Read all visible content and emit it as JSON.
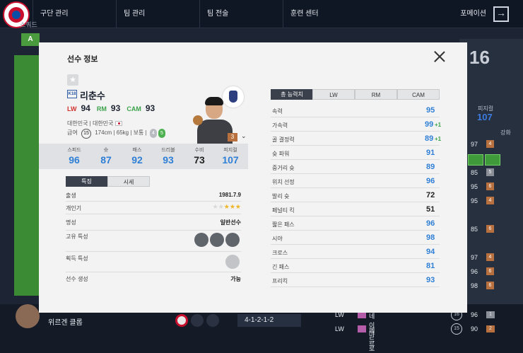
{
  "background": {
    "nav": [
      "구단 관리",
      "팀 관리",
      "팀 전술",
      "훈련 센터"
    ],
    "nav_right": "포메이션",
    "side_label": "스쿼드",
    "grade_chip": "A",
    "bg_number": "16",
    "bg_ovr_label": "피지컬",
    "bg_ovr_value": "107",
    "bg_enhance_label": "강화",
    "bg_rows": [
      {
        "val": "97",
        "badge": "4"
      },
      {
        "val": "85",
        "badge": "5"
      },
      {
        "val": "95",
        "badge": "6"
      },
      {
        "val": "95",
        "badge": "4"
      },
      {
        "val": "85",
        "badge": "6"
      },
      {
        "val": "97",
        "badge": "4"
      },
      {
        "val": "96",
        "badge": "6"
      },
      {
        "val": "98",
        "badge": "6"
      }
    ],
    "coach_name": "위르겐 클롭",
    "formation": "4-1-2-1-2",
    "sub_rows": [
      {
        "pos": "LW",
        "name": "네이마르",
        "num": "16",
        "val": "96",
        "badge": "1"
      },
      {
        "pos": "LW",
        "name": "페드로",
        "num": "15",
        "val": "90",
        "badge": "2"
      }
    ]
  },
  "modal": {
    "title": "선수 정보",
    "player": {
      "season": "K18",
      "name": "리춘수",
      "positions": [
        {
          "pos": "LW",
          "val": "94"
        },
        {
          "pos": "RM",
          "val": "93"
        },
        {
          "pos": "CAM",
          "val": "93"
        }
      ],
      "nation_line": "대한민국 | 대한민국",
      "pay_label": "급여",
      "pay": "15",
      "height": "174cm",
      "weight": "65kg",
      "body": "보통",
      "weak_foot": "4",
      "strong_foot": "5",
      "grade": "3"
    },
    "summary_stats": [
      {
        "label": "스피드",
        "value": "96",
        "color": "#2f7fd6"
      },
      {
        "label": "슛",
        "value": "87",
        "color": "#2f7fd6"
      },
      {
        "label": "패스",
        "value": "92",
        "color": "#2f7fd6"
      },
      {
        "label": "드리블",
        "value": "93",
        "color": "#2f7fd6"
      },
      {
        "label": "수비",
        "value": "73",
        "color": "#222222"
      },
      {
        "label": "피지컬",
        "value": "107",
        "color": "#2f7fd6"
      }
    ],
    "tabs": [
      "특징",
      "시세"
    ],
    "details": {
      "birth_label": "출생",
      "birth": "1981.7.9",
      "pop_label": "개인기",
      "fame_label": "명성",
      "fame": "일반선수",
      "unique_label": "고유 특성",
      "earned_label": "획득 특성",
      "gen_label": "선수 생성",
      "gen": "가능"
    },
    "attr_tabs": [
      "총 능력치",
      "LW",
      "RM",
      "CAM"
    ],
    "attributes": [
      {
        "label": "속력",
        "value": "95",
        "bonus": ""
      },
      {
        "label": "가속력",
        "value": "99",
        "bonus": "+1"
      },
      {
        "label": "골 결정력",
        "value": "89",
        "bonus": "+1"
      },
      {
        "label": "슛 파워",
        "value": "91",
        "bonus": ""
      },
      {
        "label": "중거리 슛",
        "value": "89",
        "bonus": ""
      },
      {
        "label": "위치 선정",
        "value": "96",
        "bonus": ""
      },
      {
        "label": "발리 슛",
        "value": "72",
        "bonus": ""
      },
      {
        "label": "페널티 킥",
        "value": "51",
        "bonus": ""
      },
      {
        "label": "짧은 패스",
        "value": "96",
        "bonus": ""
      },
      {
        "label": "시야",
        "value": "98",
        "bonus": ""
      },
      {
        "label": "크로스",
        "value": "94",
        "bonus": ""
      },
      {
        "label": "긴 패스",
        "value": "81",
        "bonus": ""
      },
      {
        "label": "프리킥",
        "value": "93",
        "bonus": ""
      }
    ],
    "colors": {
      "blue": "#2f7fd6",
      "dark": "#222222",
      "green": "#3aa24a",
      "red": "#d0312d"
    }
  }
}
